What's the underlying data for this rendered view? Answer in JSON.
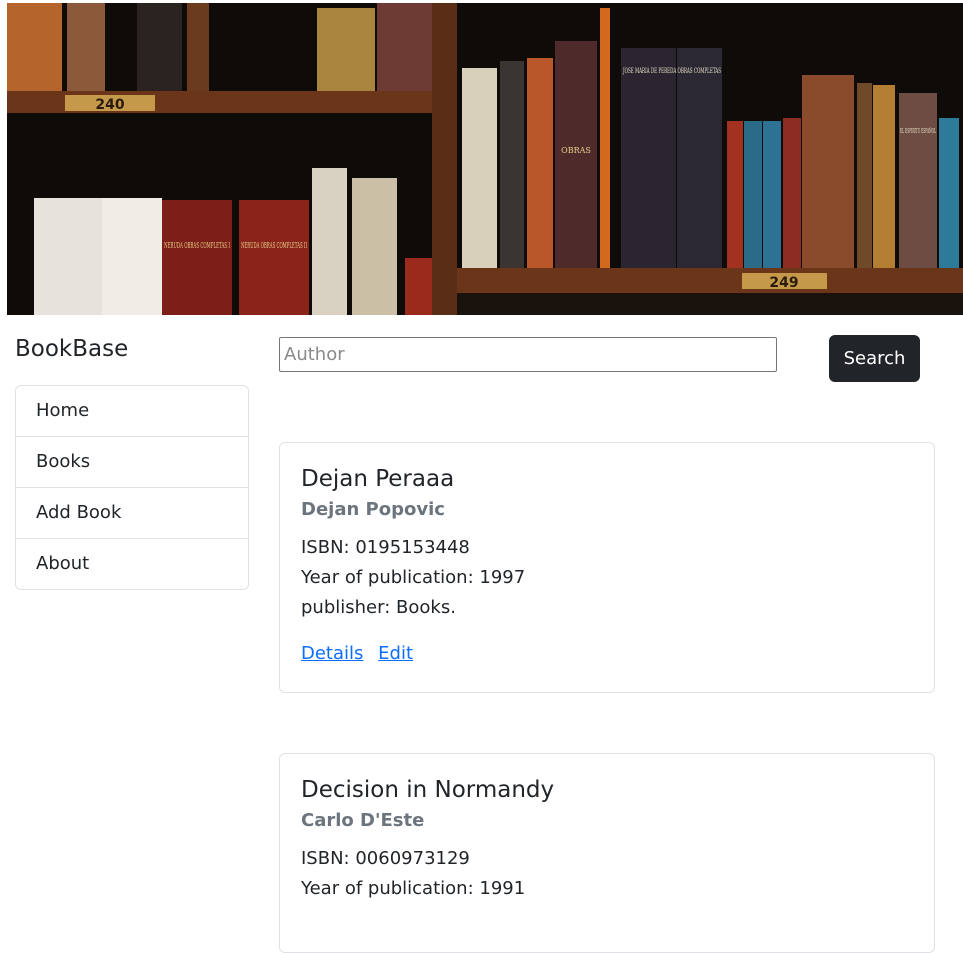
{
  "brand": {
    "name": "BookBase"
  },
  "hero": {
    "shelf_labels": [
      "240",
      "249"
    ],
    "spine_text": [
      "NERUDA OBRAS COMPLETAS I",
      "NERUDA OBRAS COMPLETAS II",
      "JOSE MARIA DE PEREDA OBRAS COMPLETAS",
      "OBRAS",
      "EL ESPIRITU ESPAÑOL"
    ]
  },
  "nav": {
    "items": [
      {
        "label": "Home"
      },
      {
        "label": "Books"
      },
      {
        "label": "Add Book"
      },
      {
        "label": "About"
      }
    ]
  },
  "search": {
    "placeholder": "Author",
    "value": "",
    "button_label": "Search"
  },
  "books": [
    {
      "title": "Dejan Peraaa",
      "author": "Dejan Popovic",
      "isbn_label": "ISBN:",
      "isbn": "0195153448",
      "year_label": "Year of publication:",
      "year": "1997",
      "publisher_label": "publisher:",
      "publisher": "Books.",
      "details_label": "Details",
      "edit_label": "Edit"
    },
    {
      "title": "Decision in Normandy",
      "author": "Carlo D'Este",
      "isbn_label": "ISBN:",
      "isbn": "0060973129",
      "year_label": "Year of publication:",
      "year": "1991"
    }
  ],
  "colors": {
    "button_dark": "#212529",
    "link": "#0d6efd",
    "muted": "#6c757d",
    "border": "#dee2e6"
  }
}
